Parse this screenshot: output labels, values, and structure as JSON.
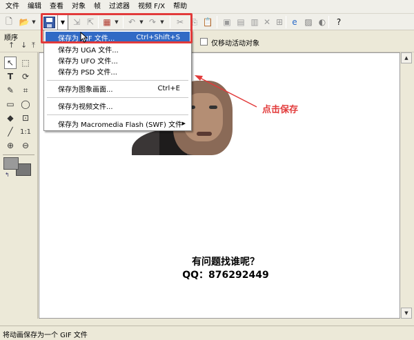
{
  "menubar": {
    "items": [
      "文件",
      "编辑",
      "查看",
      "对象",
      "帧",
      "过滤器",
      "视频 F/X",
      "帮助"
    ]
  },
  "toolbar": {
    "icons": [
      "new-file-icon",
      "open-folder-icon",
      "save-disk-icon",
      "import-icon",
      "export-icon",
      "color-palette-icon",
      "undo-icon",
      "redo-icon",
      "cut-icon",
      "copy-icon",
      "paste-icon",
      "frame-icon",
      "help-icon"
    ]
  },
  "seqbar": {
    "label": "顺序",
    "checkbox_label": "仅移动活动对象",
    "checked": false
  },
  "menu": {
    "items": [
      {
        "label": "保存为 GIF 文件...",
        "shortcut": "Ctrl+Shift+S",
        "highlighted": true
      },
      {
        "label": "保存为 UGA 文件...",
        "shortcut": ""
      },
      {
        "label": "保存为 UFO 文件...",
        "shortcut": ""
      },
      {
        "label": "保存为 PSD 文件...",
        "shortcut": ""
      },
      {
        "label": "保存为图象画面...",
        "shortcut": "Ctrl+E"
      },
      {
        "label": "保存为视频文件...",
        "shortcut": ""
      },
      {
        "label": "保存为 Macromedia Flash (SWF) 文件",
        "shortcut": "",
        "submenu": true
      }
    ]
  },
  "canvas": {
    "line1": "有问题找谁呢？",
    "line2": "QQ：876292449"
  },
  "annotation": {
    "text": "点击保存",
    "color": "#e23a3a"
  },
  "statusbar": {
    "text": "将动画保存为一个 GIF 文件"
  },
  "colors": {
    "highlight": "#316ac5",
    "annotation_red": "#e23a3a"
  }
}
